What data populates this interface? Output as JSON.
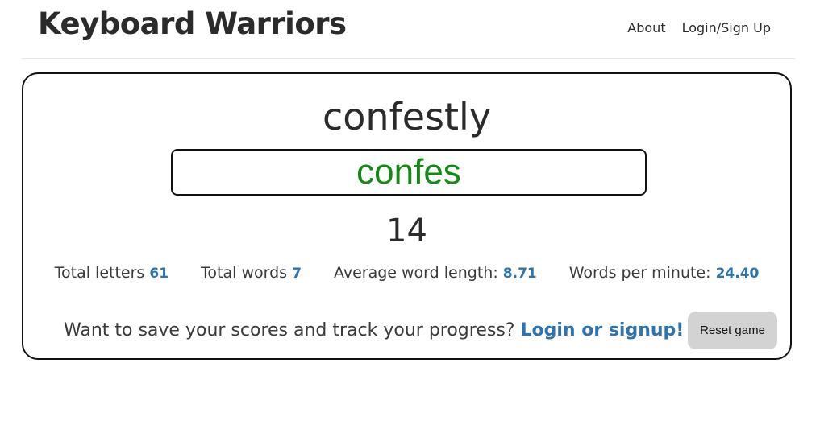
{
  "header": {
    "brand": "Keyboard Warriors",
    "nav": {
      "about": "About",
      "login": "Login/Sign Up"
    }
  },
  "game": {
    "target_word": "confestly",
    "typed_value": "confes",
    "timer": "14",
    "stats": {
      "total_letters_label": "Total letters",
      "total_letters_value": "61",
      "total_words_label": "Total words",
      "total_words_value": "7",
      "avg_word_length_label": "Average word length:",
      "avg_word_length_value": "8.71",
      "wpm_label": "Words per minute:",
      "wpm_value": "24.40"
    },
    "promo_text": "Want to save your scores and track your progress?",
    "promo_link": "Login or signup!",
    "reset_label": "Reset game"
  },
  "colors": {
    "typed_text": "#148a14",
    "accent_blue": "#2d73b0",
    "reset_bg": "#d3d3d3"
  }
}
